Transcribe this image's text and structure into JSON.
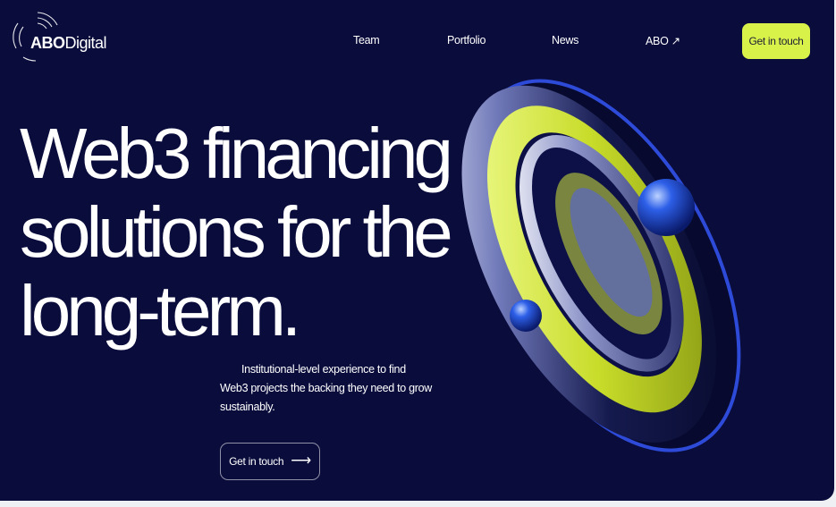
{
  "logo": {
    "bold": "ABO",
    "light": "Digital"
  },
  "nav": {
    "team": "Team",
    "portfolio": "Portfolio",
    "news": "News",
    "abo": "ABO ↗"
  },
  "header_cta": "Get in touch",
  "hero": {
    "headline_lines": [
      "Web3 financing",
      "solutions for the",
      "long-term."
    ],
    "subtext": "Institutional-level experience to find Web3 projects the backing they need to grow sustainably.",
    "cta": "Get in touch",
    "cta_arrow": "⟶"
  },
  "colors": {
    "background": "#0a0c3c",
    "accent": "#d9f24a",
    "text": "#ffffff"
  },
  "icons": [
    "logo-rings-icon",
    "external-arrow-icon",
    "arrow-right-icon"
  ]
}
